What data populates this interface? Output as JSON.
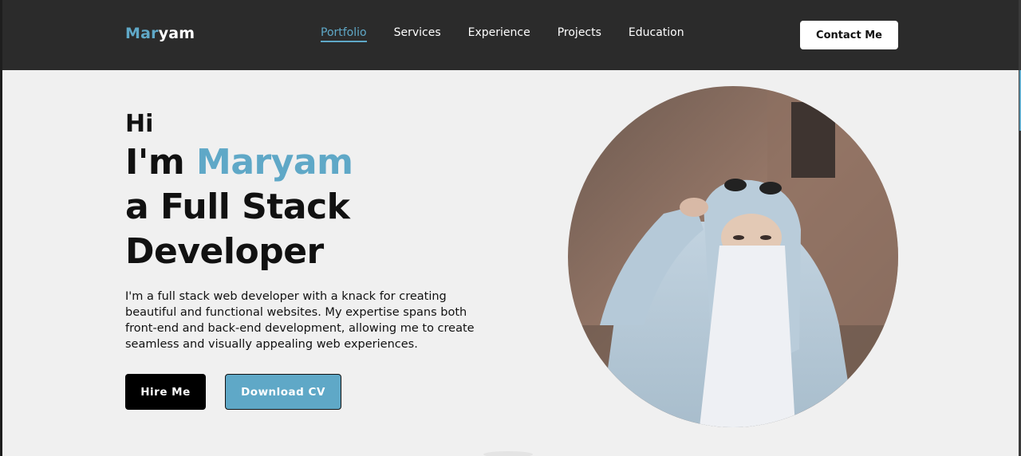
{
  "brand": {
    "logo_part1": "Mar",
    "logo_part2": "yam",
    "accent_color": "#5fa8c7"
  },
  "nav": {
    "items": [
      {
        "label": "Portfolio",
        "active": true
      },
      {
        "label": "Services",
        "active": false
      },
      {
        "label": "Experience",
        "active": false
      },
      {
        "label": "Projects",
        "active": false
      },
      {
        "label": "Education",
        "active": false
      }
    ]
  },
  "header": {
    "contact_label": "Contact Me",
    "background": "#2b2b2b"
  },
  "hero": {
    "greeting": "Hi",
    "intro_prefix": "I'm",
    "name": "Maryam",
    "role_line1": "a Full Stack",
    "role_line2": "Developer",
    "description": "I'm a full stack web developer with a knack for creating beautiful and functional websites. My expertise spans both front-end and back-end development, allowing me to create seamless and visually appealing web experiences.",
    "hire_label": "Hire Me",
    "cv_label": "Download CV"
  },
  "portrait": {
    "icon": "profile-photo"
  }
}
